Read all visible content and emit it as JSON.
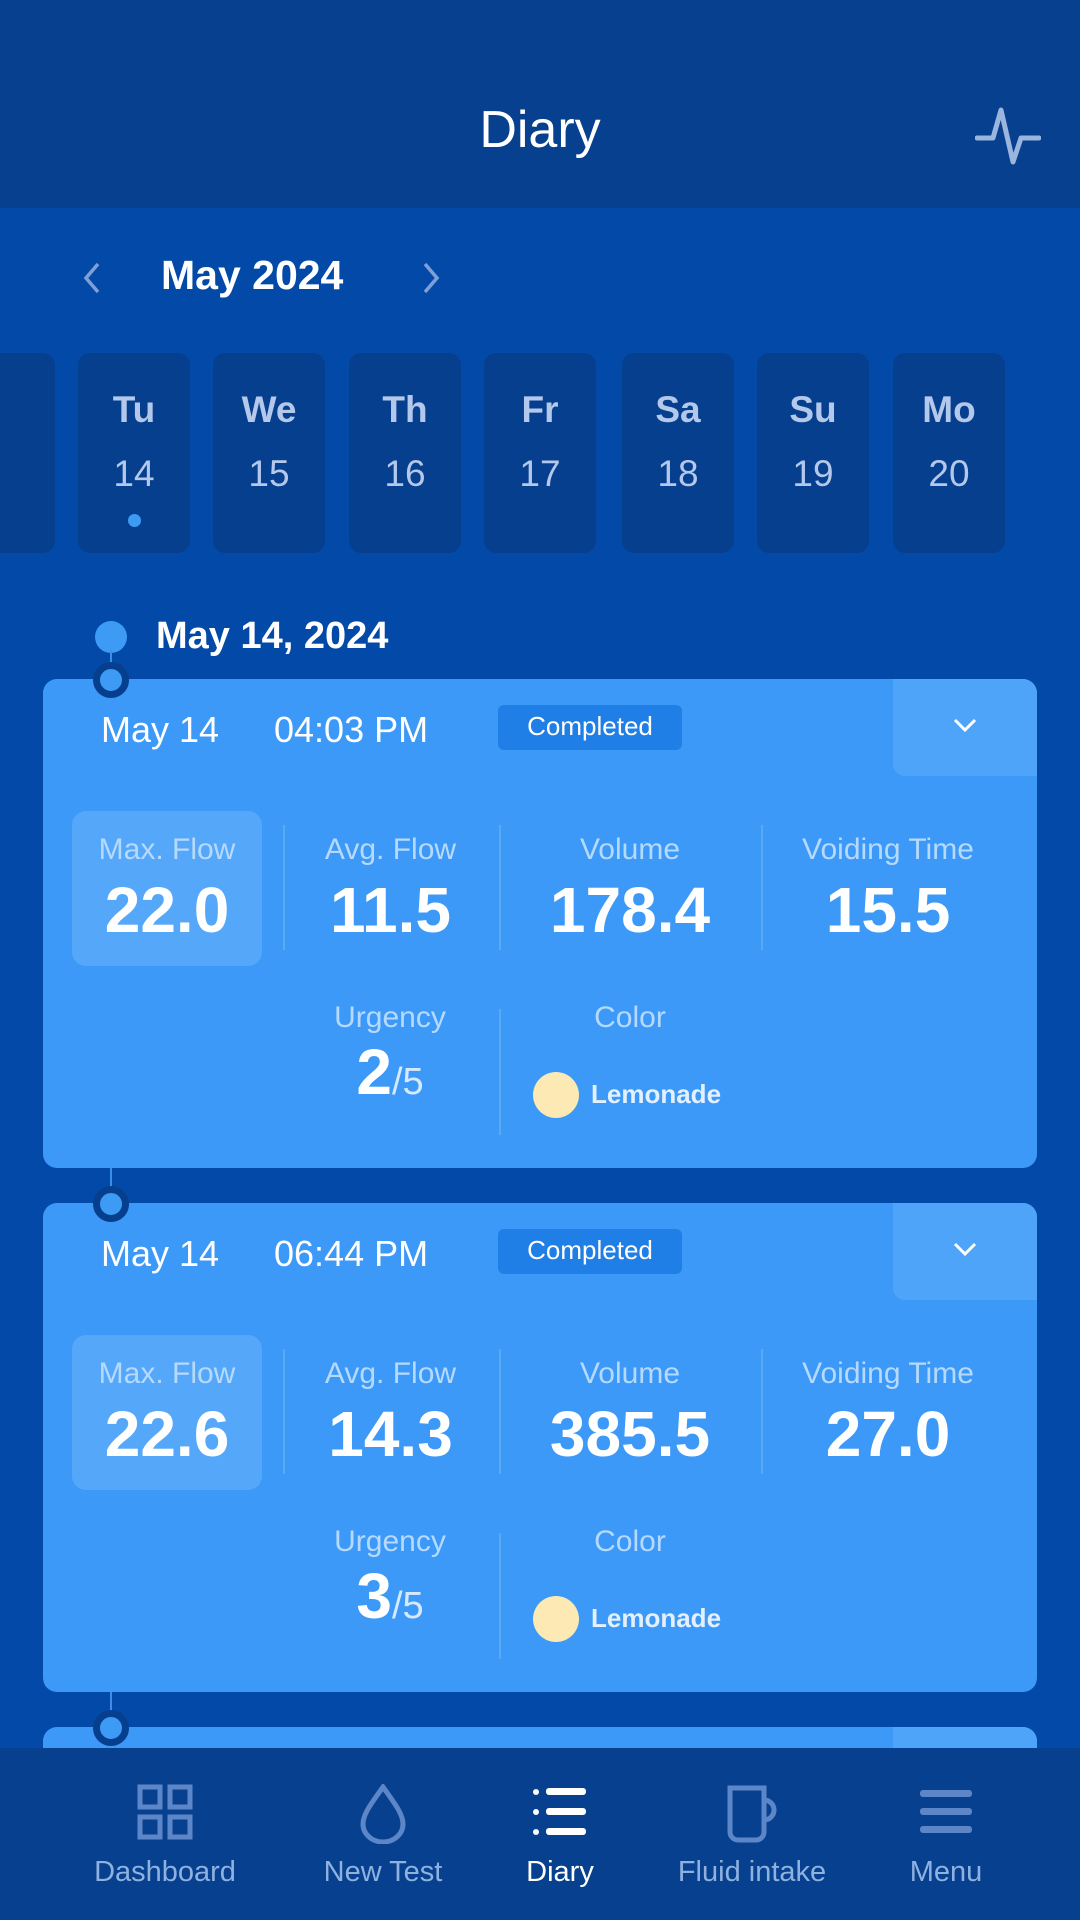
{
  "header": {
    "title": "Diary",
    "action_icon": "activity-icon"
  },
  "calendar": {
    "month": "May 2024",
    "days": [
      {
        "abbr": "Tu",
        "num": "14",
        "has_entries": true,
        "selected": true
      },
      {
        "abbr": "We",
        "num": "15"
      },
      {
        "abbr": "Th",
        "num": "16"
      },
      {
        "abbr": "Fr",
        "num": "17"
      },
      {
        "abbr": "Sa",
        "num": "18"
      },
      {
        "abbr": "Su",
        "num": "19"
      },
      {
        "abbr": "Mo",
        "num": "20"
      }
    ]
  },
  "date_heading": "May 14, 2024",
  "entries": [
    {
      "date": "May 14",
      "time": "04:03 PM",
      "status": "Completed",
      "stats": [
        {
          "label": "Max. Flow",
          "value": "22.0"
        },
        {
          "label": "Avg. Flow",
          "value": "11.5"
        },
        {
          "label": "Volume",
          "value": "178.4"
        },
        {
          "label": "Voiding Time",
          "value": "15.5"
        }
      ],
      "urgency_label": "Urgency",
      "urgency": "2",
      "urgency_max": "/5",
      "color_label": "Color",
      "color": "Lemonade",
      "color_hex": "#fde9b4"
    },
    {
      "date": "May 14",
      "time": "06:44 PM",
      "status": "Completed",
      "stats": [
        {
          "label": "Max. Flow",
          "value": "22.6"
        },
        {
          "label": "Avg. Flow",
          "value": "14.3"
        },
        {
          "label": "Volume",
          "value": "385.5"
        },
        {
          "label": "Voiding Time",
          "value": "27.0"
        }
      ],
      "urgency_label": "Urgency",
      "urgency": "3",
      "urgency_max": "/5",
      "color_label": "Color",
      "color": "Lemonade",
      "color_hex": "#fde9b4"
    }
  ],
  "nav": [
    {
      "label": "Dashboard",
      "icon": "grid-icon"
    },
    {
      "label": "New Test",
      "icon": "drop-icon"
    },
    {
      "label": "Diary",
      "icon": "list-icon",
      "active": true
    },
    {
      "label": "Fluid intake",
      "icon": "mug-icon"
    },
    {
      "label": "Menu",
      "icon": "menu-icon"
    }
  ],
  "colors": {
    "header": "#06408e",
    "background": "#034aa8",
    "card": "#3d99f7",
    "accent": "#3d9af5"
  }
}
